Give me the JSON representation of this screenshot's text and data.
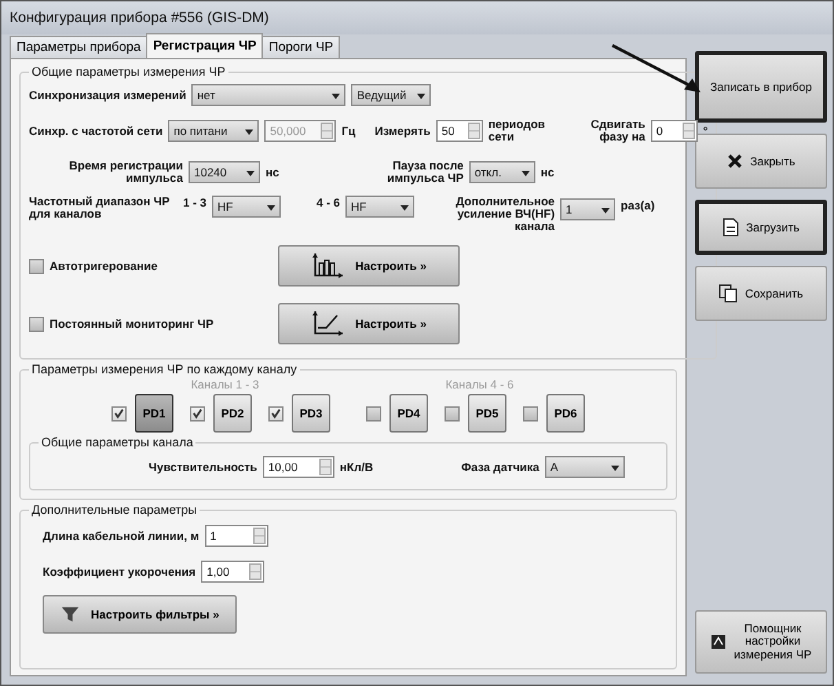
{
  "window": {
    "title": "Конфигурация прибора #556 (GIS-DM)"
  },
  "tabs": [
    {
      "label": "Параметры прибора",
      "selected": false
    },
    {
      "label": "Регистрация ЧР",
      "selected": true
    },
    {
      "label": "Пороги ЧР",
      "selected": false
    }
  ],
  "general": {
    "title": "Общие параметры измерения ЧР",
    "sync": {
      "label": "Синхронизация измерений",
      "mode": "нет",
      "role": "Ведущий"
    },
    "mains": {
      "label": "Синхр. с частотой сети",
      "source": "по питани",
      "frequency": "50,000",
      "frequency_disabled": true,
      "unit": "Гц"
    },
    "measure": {
      "label": "Измерять",
      "value": "50",
      "unit": "периодов сети"
    },
    "phase_shift": {
      "label": "Сдвигать фазу на",
      "value": "0",
      "unit": "°"
    },
    "reg_time": {
      "label": "Время регистрации импульса",
      "value": "10240",
      "unit": "нс"
    },
    "pause": {
      "label": "Пауза после импульса ЧР",
      "value": "откл.",
      "unit": "нс"
    },
    "band": {
      "label": "Частотный диапазон ЧР для каналов",
      "groups": [
        {
          "label": "1 - 3",
          "value": "HF"
        },
        {
          "label": "4 - 6",
          "value": "HF"
        }
      ]
    },
    "gain": {
      "label": "Дополнительное усиление ВЧ(HF) канала",
      "value": "1",
      "unit": "раз(а)"
    },
    "options": [
      {
        "label": "Автотригерование",
        "checked": false,
        "button": "Настроить »",
        "kind": "bars"
      },
      {
        "label": "Постоянный мониторинг ЧР",
        "checked": false,
        "button": "Настроить »",
        "kind": "ramp"
      }
    ]
  },
  "per_channel": {
    "title": "Параметры измерения ЧР по каждому каналу",
    "groups": [
      {
        "label": "Каналы 1 - 3",
        "channels": [
          {
            "name": "PD1",
            "checked": true,
            "selected": true
          },
          {
            "name": "PD2",
            "checked": true,
            "selected": false
          },
          {
            "name": "PD3",
            "checked": true,
            "selected": false
          }
        ]
      },
      {
        "label": "Каналы 4 - 6",
        "channels": [
          {
            "name": "PD4",
            "checked": false,
            "selected": false
          },
          {
            "name": "PD5",
            "checked": false,
            "selected": false
          },
          {
            "name": "PD6",
            "checked": false,
            "selected": false
          }
        ]
      }
    ],
    "channel_params": {
      "title": "Общие параметры канала",
      "sensitivity": {
        "label": "Чувствительность",
        "value": "10,00",
        "unit": "нКл/В"
      },
      "phase": {
        "label": "Фаза датчика",
        "value": "A"
      }
    }
  },
  "extra": {
    "title": "Дополнительные параметры",
    "cable": {
      "label": "Длина кабельной линии, м",
      "value": "1"
    },
    "factor": {
      "label": "Коэффициент укорочения",
      "value": "1,00"
    },
    "filters_button": "Настроить фильтры »"
  },
  "actions": [
    {
      "label": "Записать в прибор",
      "kind": "plain",
      "highlighted": true
    },
    {
      "label": "Закрыть",
      "kind": "close",
      "highlighted": false
    },
    {
      "label": "Загрузить",
      "kind": "load",
      "highlighted": true
    },
    {
      "label": "Сохранить",
      "kind": "save",
      "highlighted": false
    }
  ],
  "helper": {
    "label": "Помощник настройки измерения ЧР"
  }
}
